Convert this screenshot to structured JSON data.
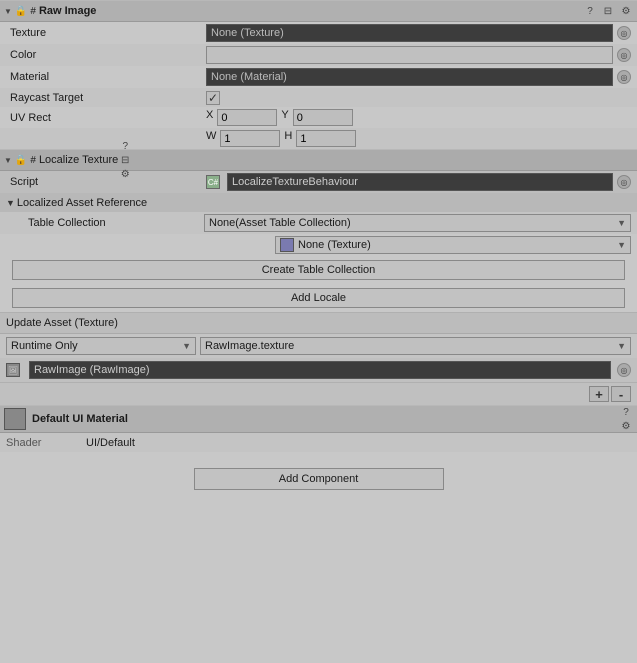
{
  "rawImage": {
    "header": {
      "title": "Raw Image",
      "help_icon": "?",
      "settings_icon": "⚙",
      "layout_icon": "⊟"
    },
    "props": {
      "texture_label": "Texture",
      "texture_value": "None (Texture)",
      "color_label": "Color",
      "material_label": "Material",
      "material_value": "None (Material)",
      "raycast_label": "Raycast Target",
      "uv_label": "UV Rect",
      "x_label": "X",
      "x_value": "0",
      "y_label": "Y",
      "y_value": "0",
      "w_label": "W",
      "w_value": "1",
      "h_label": "H",
      "h_value": "1"
    }
  },
  "localizeTexture": {
    "header": {
      "title": "Localize Texture",
      "help_icon": "?",
      "settings_icon": "⚙",
      "layout_icon": "⊟"
    },
    "script_label": "Script",
    "script_value": "LocalizeTextureBehaviour",
    "localized_asset_ref": "Localized Asset Reference",
    "table_collection_label": "Table Collection",
    "table_collection_value": "None(Asset Table Collection)",
    "none_texture_label": "None (Texture)",
    "create_table_btn": "Create Table Collection",
    "add_locale_btn": "Add Locale",
    "update_asset_label": "Update Asset (Texture)",
    "runtime_label": "Runtime Only",
    "runtime_value": "RawImage.texture",
    "rawimage_label": "RawImage (RawImage)"
  },
  "defaultMaterial": {
    "title": "Default UI Material",
    "help_icon": "?",
    "settings_icon": "⚙",
    "shader_label": "Shader",
    "shader_value": "UI/Default"
  },
  "addComponent": {
    "label": "Add Component"
  },
  "plusminus": {
    "plus": "+",
    "minus": "-"
  }
}
